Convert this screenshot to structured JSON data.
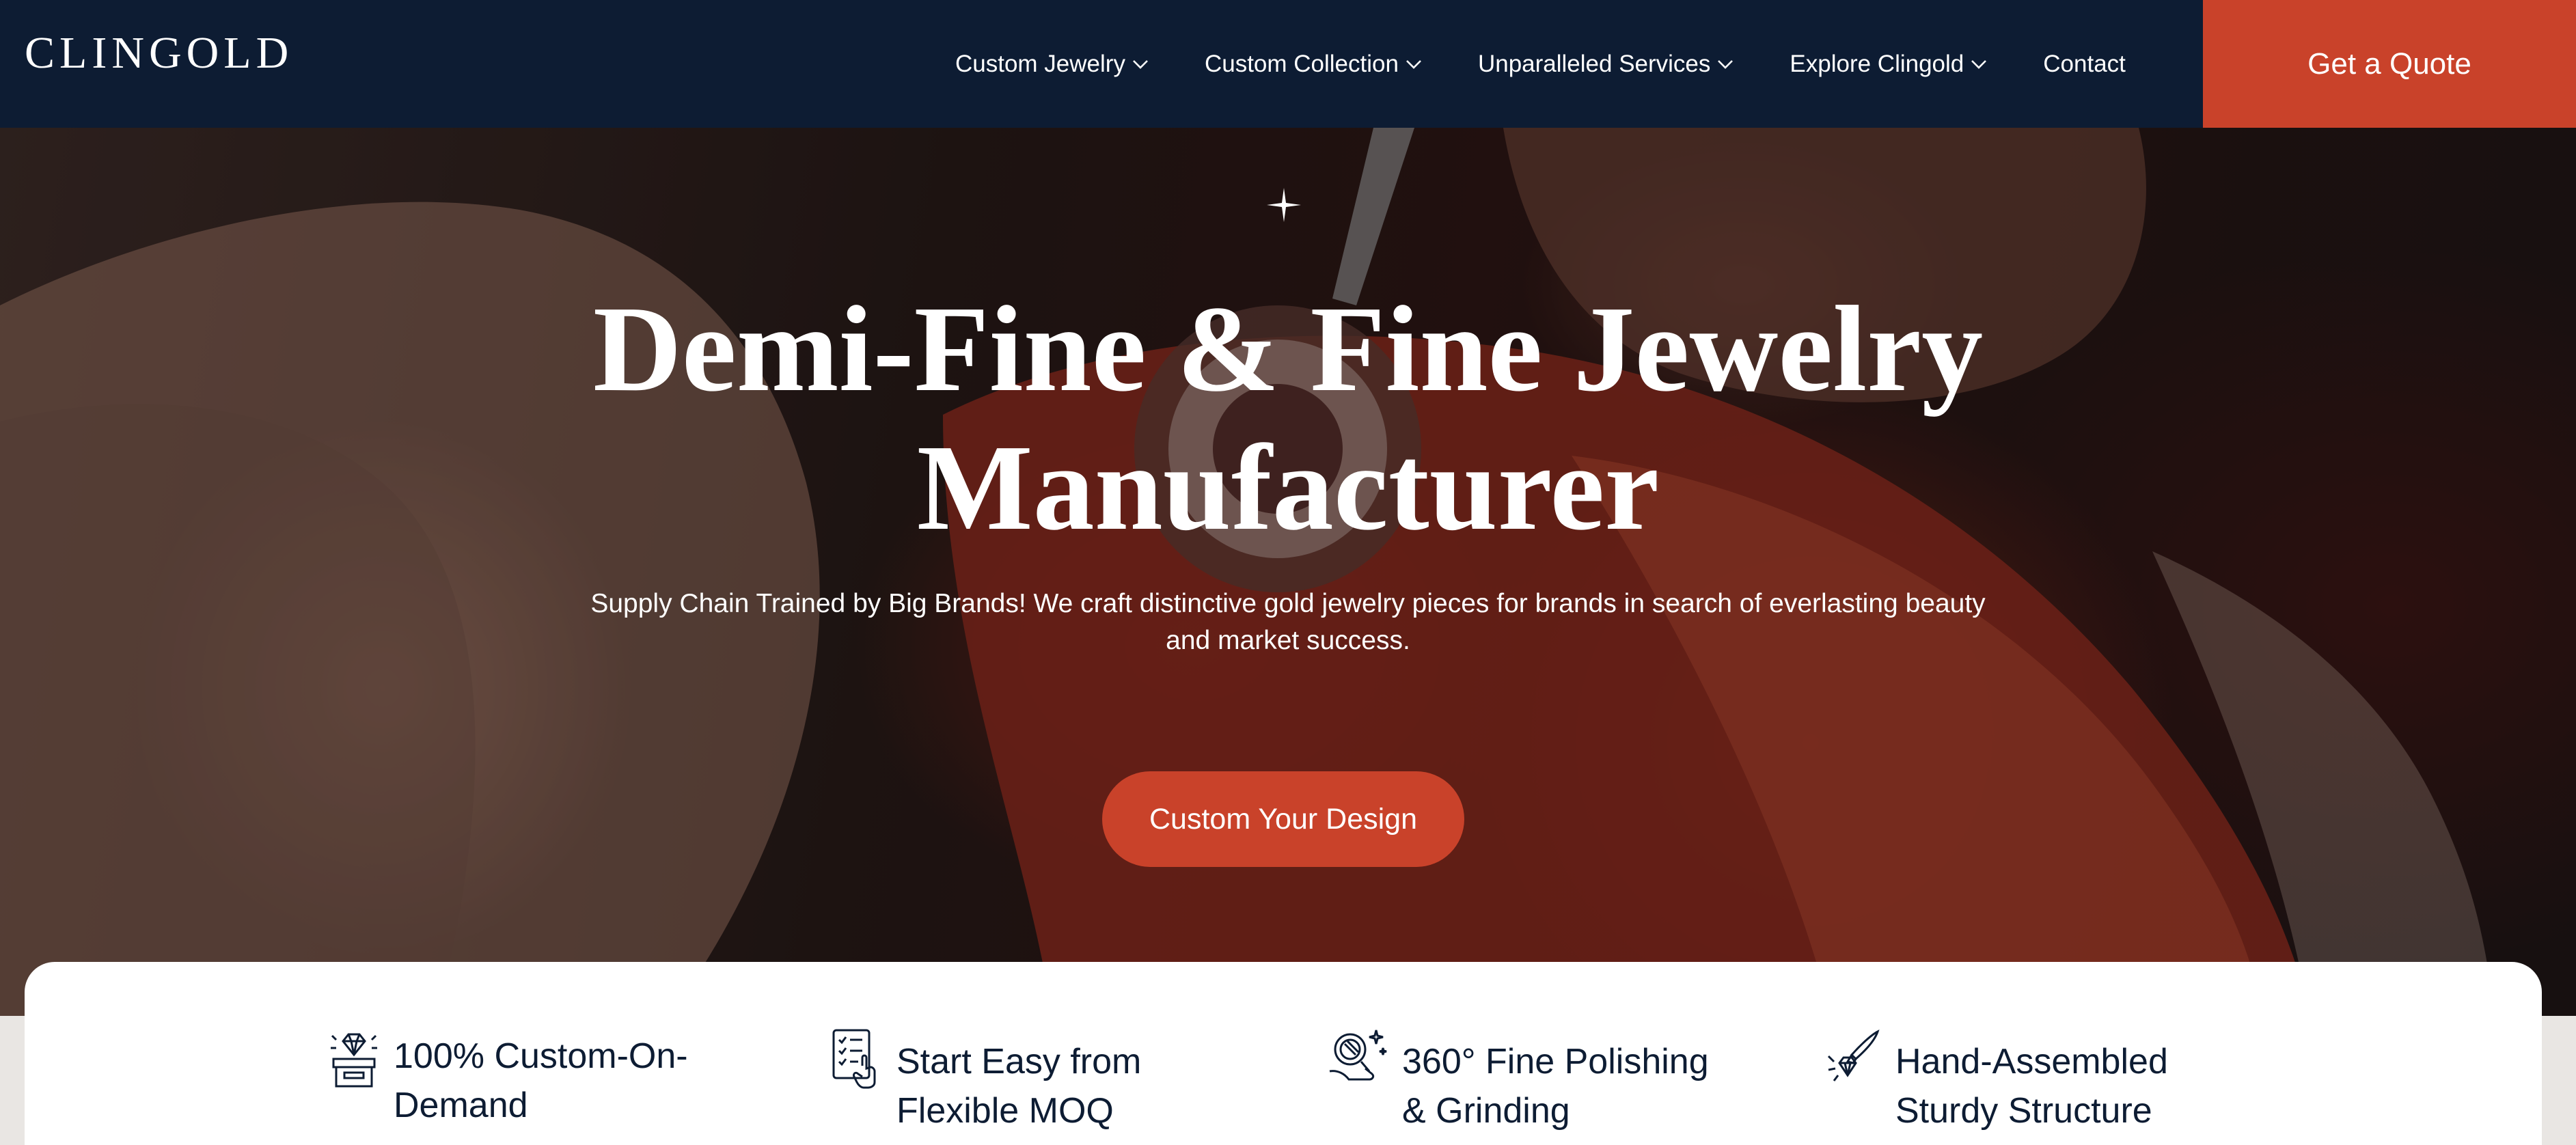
{
  "brand": {
    "logo_text": "CLINGOLD"
  },
  "nav": {
    "items": [
      {
        "label": "Custom Jewelry",
        "has_dropdown": true
      },
      {
        "label": "Custom Collection",
        "has_dropdown": true
      },
      {
        "label": "Unparalleled Services",
        "has_dropdown": true
      },
      {
        "label": "Explore Clingold",
        "has_dropdown": true
      },
      {
        "label": "Contact",
        "has_dropdown": false
      }
    ],
    "quote_button": "Get a Quote"
  },
  "hero": {
    "title_line1": "Demi-Fine & Fine Jewelry",
    "title_line2": "Manufacturer",
    "subtitle": "Supply Chain Trained by Big Brands! We craft distinctive gold jewelry pieces for brands in search of everlasting beauty and market success.",
    "cta": "Custom Your Design",
    "sparkle_icon": "sparkle-icon"
  },
  "features": [
    {
      "line1": "100% Custom-On-",
      "line2": "Demand",
      "icon": "jewelry-box-icon"
    },
    {
      "line1": "Start Easy from",
      "line2": "Flexible MOQ",
      "icon": "checklist-hand-icon"
    },
    {
      "line1": "360° Fine Polishing",
      "line2": "& Grinding",
      "icon": "polishing-ring-icon"
    },
    {
      "line1": "Hand-Assembled",
      "line2": "Sturdy Structure",
      "icon": "assembly-tool-icon"
    }
  ],
  "colors": {
    "navy": "#0d1c33",
    "accent": "#c9422a",
    "white": "#ffffff"
  }
}
